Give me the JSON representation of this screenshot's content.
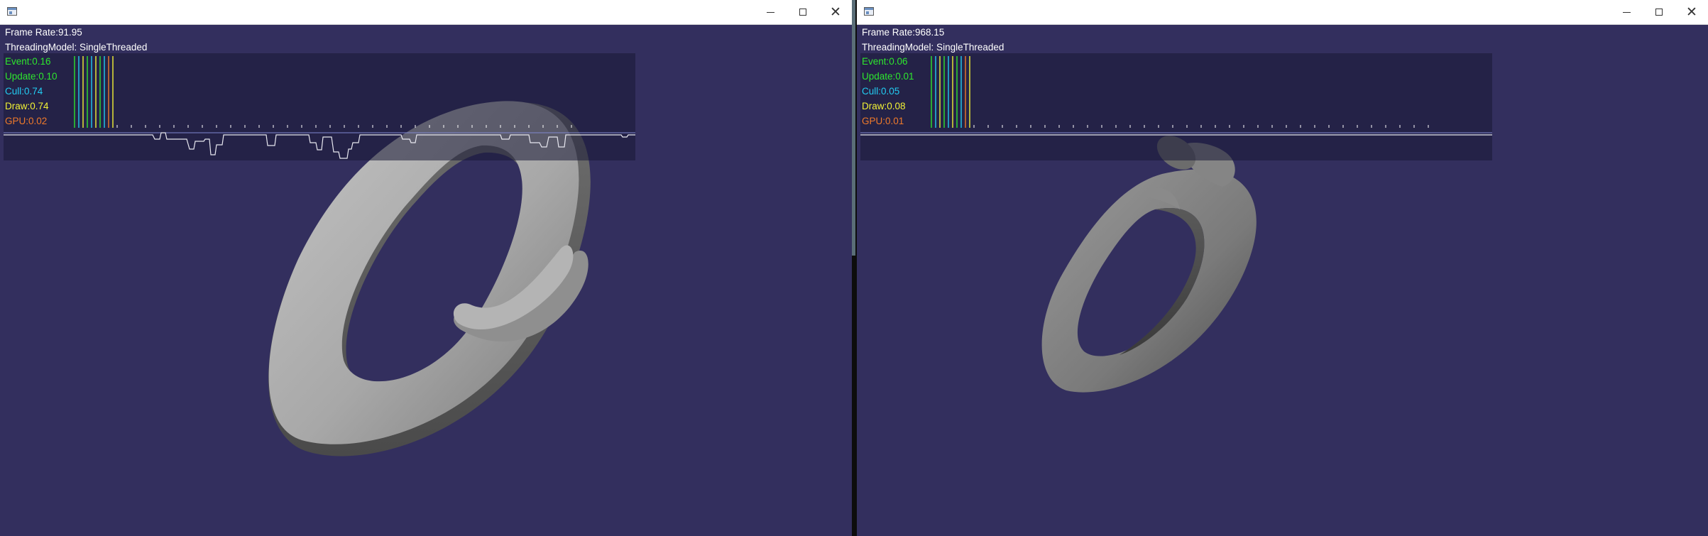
{
  "left_window": {
    "frame_rate": "Frame Rate:91.95",
    "threading_model": "ThreadingModel: SingleThreaded",
    "stats": [
      {
        "label": "Event:0.16",
        "color": "#2ee62e"
      },
      {
        "label": "Update:0.10",
        "color": "#2ee62e"
      },
      {
        "label": "Cull:0.74",
        "color": "#22ccf2"
      },
      {
        "label": "Draw:0.74",
        "color": "#f2f235"
      },
      {
        "label": "GPU:0.02",
        "color": "#f07a2a"
      }
    ]
  },
  "right_window": {
    "frame_rate": "Frame Rate:968.15",
    "threading_model": "ThreadingModel: SingleThreaded",
    "stats": [
      {
        "label": "Event:0.06",
        "color": "#2ee62e"
      },
      {
        "label": "Update:0.01",
        "color": "#2ee62e"
      },
      {
        "label": "Cull:0.05",
        "color": "#22ccf2"
      },
      {
        "label": "Draw:0.08",
        "color": "#f2f235"
      },
      {
        "label": "GPU:0.01",
        "color": "#f07a2a"
      }
    ]
  },
  "titlebar_icons": {
    "minimize": "minimize-icon",
    "maximize": "maximize-icon",
    "close": "close-icon",
    "close_glyph": "✕"
  },
  "colors": {
    "scene_background": "#332f5e",
    "stats_text_event": "#2ee62e",
    "stats_text_cull": "#22ccf2",
    "stats_text_draw": "#f2f235",
    "stats_text_gpu": "#f07a2a"
  }
}
